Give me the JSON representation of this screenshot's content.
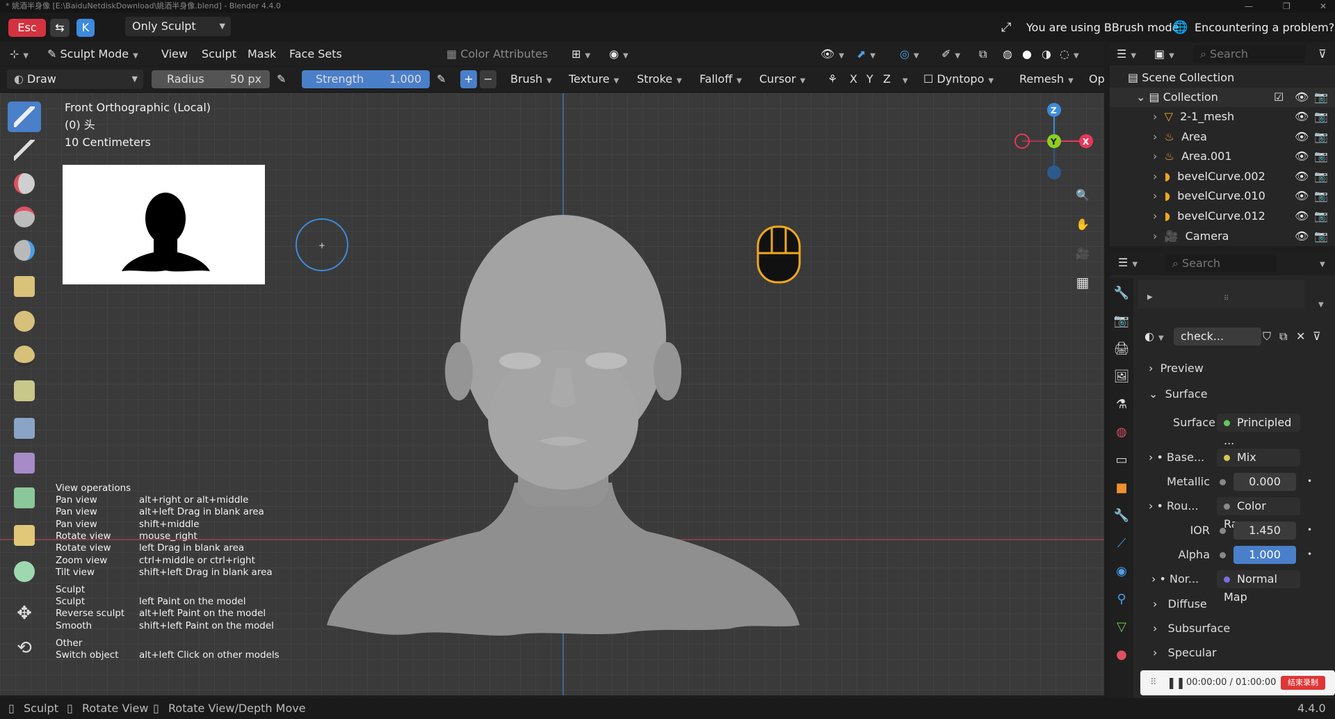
{
  "titlebar": {
    "text": "* 姚酒半身像 [E:\\BaiduNetdiskDownload\\姚酒半身像.blend] - Blender 4.4.0"
  },
  "topbar": {
    "esc_key": "Esc",
    "k_key": "K",
    "workspace_filter": "Only Sculpt",
    "bbrush_notice": "You are using BBrush mode",
    "problem_link": "Encountering a problem?"
  },
  "viewport_header": {
    "mode": "Sculpt Mode",
    "menus": [
      "View",
      "Sculpt",
      "Mask",
      "Face Sets"
    ],
    "color_attributes": "Color Attributes"
  },
  "tool_header": {
    "brush_name": "Draw",
    "radius_label": "Radius",
    "radius_value": "50 px",
    "strength_label": "Strength",
    "strength_value": "1.000",
    "plus": "+",
    "minus": "−",
    "menus": [
      "Brush",
      "Texture",
      "Stroke",
      "Falloff",
      "Cursor"
    ],
    "axes": [
      "X",
      "Y",
      "Z"
    ],
    "dyntopo": "Dyntopo",
    "remesh": "Remesh",
    "options_short": "Op"
  },
  "viewport": {
    "view_name": "Front Orthographic (Local)",
    "object_info": "(0) 头",
    "scale": "10 Centimeters",
    "gizmo_labels": {
      "z": "Z",
      "y": "Y",
      "x": "X"
    }
  },
  "help": {
    "sections": [
      {
        "title": "View operations",
        "rows": [
          [
            "Pan view",
            "alt+right or alt+middle"
          ],
          [
            "Pan view",
            "alt+left Drag in blank area"
          ],
          [
            "Pan view",
            "shift+middle"
          ],
          [
            "Rotate view",
            "mouse_right"
          ],
          [
            "Rotate view",
            "left Drag in blank area"
          ],
          [
            "Zoom view",
            "ctrl+middle or ctrl+right"
          ],
          [
            "Tilt view",
            "shift+left Drag in blank area"
          ]
        ]
      },
      {
        "title": "Sculpt",
        "rows": [
          [
            "Sculpt",
            "left Paint on the model"
          ],
          [
            "Reverse sculpt",
            "alt+left Paint on the model"
          ],
          [
            "Smooth",
            "shift+left Paint on the model"
          ]
        ]
      },
      {
        "title": "Other",
        "rows": [
          [
            "Switch object",
            "alt+left Click on other models"
          ]
        ]
      }
    ]
  },
  "outliner": {
    "search_placeholder": "Search",
    "scene_collection": "Scene Collection",
    "collection": "Collection",
    "items": [
      "2-1_mesh",
      "Area",
      "Area.001",
      "bevelCurve.002",
      "bevelCurve.010",
      "bevelCurve.012",
      "Camera"
    ]
  },
  "properties": {
    "search_placeholder": "Search",
    "material_name": "check...",
    "preview": "Preview",
    "surface_panel": "Surface",
    "surface_label": "Surface",
    "surface_value": "Principled ...",
    "base_label": "Base...",
    "base_value": "Mix",
    "metallic_label": "Metallic",
    "metallic_value": "0.000",
    "rough_label": "Rou...",
    "rough_value": "Color Ramp",
    "ior_label": "IOR",
    "ior_value": "1.450",
    "alpha_label": "Alpha",
    "alpha_value": "1.000",
    "normal_label": "Nor...",
    "normal_value": "Normal Map",
    "subpanels": [
      "Diffuse",
      "Subsurface",
      "Specular"
    ]
  },
  "recording": {
    "time": "00:00:00 / 01:00:00",
    "stop_label": "结束录制"
  },
  "statusbar": {
    "sculpt": "Sculpt",
    "rotate": "Rotate View",
    "rotate_depth": "Rotate View/Depth Move",
    "version": "4.4.0"
  },
  "colors": {
    "accent": "#4a7fc9",
    "gizmo_x": "#e8385a",
    "gizmo_y": "#8ccf1f",
    "gizmo_z": "#3d8bdc",
    "esc_red": "#d4323f",
    "mouse_orange": "#f0a81c"
  }
}
